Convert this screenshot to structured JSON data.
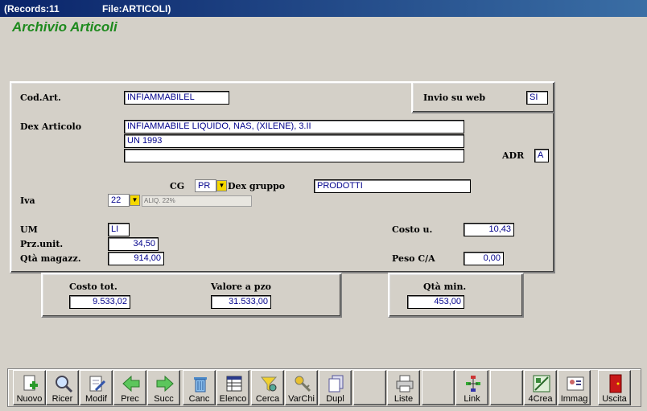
{
  "window": {
    "records": "(Records:11",
    "file": "File:ARTICOLI)"
  },
  "app_title": "Archivio Articoli",
  "labels": {
    "cod_art": "Cod.Art.",
    "invio_web": "Invio su web",
    "dex_articolo": "Dex Articolo",
    "adr": "ADR",
    "cg": "CG",
    "dex_gruppo": "Dex gruppo",
    "iva": "Iva",
    "um": "UM",
    "prz_unit": "Prz.unit.",
    "qta_magazz": "Qtà magazz.",
    "costo_u": "Costo u.",
    "peso_ca": "Peso C/A",
    "costo_tot": "Costo tot.",
    "valore_pzo": "Valore a pzo",
    "qta_min": "Qtà min."
  },
  "values": {
    "cod_art": "INFIAMMABILEL",
    "invio_web": "SI",
    "dex1": "INFIAMMABILE LIQUIDO, NAS, (XILENE), 3.II",
    "dex2": "UN 1993",
    "dex3": "",
    "adr": "A",
    "cg": "PR",
    "dex_gruppo": "PRODOTTI",
    "iva": "22",
    "iva_desc": "ALIQ. 22%",
    "um": "LI",
    "prz_unit": "34,50",
    "qta_magazz": "914,00",
    "costo_u": "10,43",
    "peso_ca": "0,00",
    "costo_tot": "9.533,02",
    "valore_pzo": "31.533,00",
    "qta_min": "453,00"
  },
  "toolbar": [
    {
      "label": "Nuovo",
      "icon": "new-doc-icon"
    },
    {
      "label": "Ricer",
      "icon": "magnifier-icon"
    },
    {
      "label": "Modif",
      "icon": "edit-doc-icon"
    },
    {
      "label": "Prec",
      "icon": "arrow-left-icon"
    },
    {
      "label": "Succ",
      "icon": "arrow-right-icon"
    },
    {
      "label": "Canc",
      "icon": "trash-icon"
    },
    {
      "label": "Elenco",
      "icon": "table-icon"
    },
    {
      "label": "Cerca",
      "icon": "filter-search-icon"
    },
    {
      "label": "VarChi",
      "icon": "keys-icon"
    },
    {
      "label": "Dupl",
      "icon": "duplicate-icon"
    },
    {
      "label": "",
      "icon": ""
    },
    {
      "label": "Liste",
      "icon": "printer-icon"
    },
    {
      "label": "",
      "icon": ""
    },
    {
      "label": "Link",
      "icon": "link-icon"
    },
    {
      "label": "",
      "icon": ""
    },
    {
      "label": "4Crea",
      "icon": "create-icon"
    },
    {
      "label": "Immag",
      "icon": "image-card-icon"
    },
    {
      "label": "Uscita",
      "icon": "exit-door-icon"
    }
  ],
  "colors": {
    "accent_title": "#1e8a1e",
    "field_text": "#00008b",
    "titlebar": "#0a246a",
    "combo_button": "#f5d800"
  }
}
